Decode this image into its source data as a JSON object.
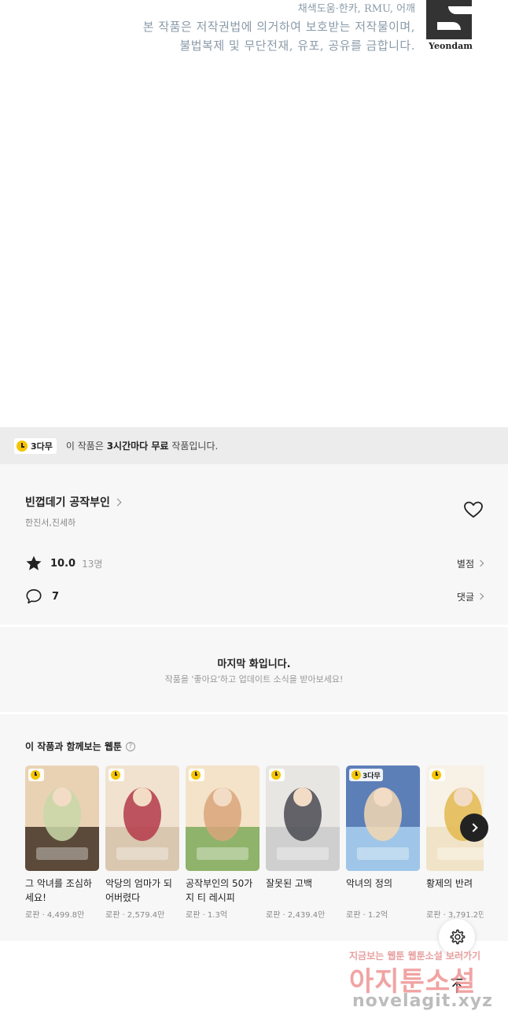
{
  "copyright": {
    "credit": "채색도움·한카, RMU, 어깨",
    "line1": "본 작품은 저작권법에 의거하여 보호받는 저작물이며,",
    "line2": "불법복제 및 무단전재, 유포, 공유를 금합니다.",
    "logo_text": "Yeondam"
  },
  "free_banner": {
    "badge": "3다무",
    "text_before": "이 작품은 ",
    "text_bold": "3시간마다 무료",
    "text_after": " 작품입니다."
  },
  "work": {
    "title": "빈껍데기 공작부인",
    "authors": "한진서,진세하",
    "rating": "10.0",
    "rating_count": "13명",
    "rating_link": "별점",
    "comment_count": "7",
    "comment_link": "댓글"
  },
  "last_episode": {
    "title": "마지막 화입니다.",
    "subtitle": "작품을 '좋아요'하고 업데이트 소식을 받아보세요!"
  },
  "recommendations": {
    "heading": "이 작품과 함께보는 웹툰",
    "items": [
      {
        "title": "그 악녀를 조심하세요!",
        "meta": "로판 · 4,499.8만",
        "badge": "",
        "colors": [
          "#5b4a3a",
          "#c9d8a8",
          "#e9d2b4"
        ]
      },
      {
        "title": "악당의 엄마가 되어버렸다",
        "meta": "로판 · 2,579.4만",
        "badge": "",
        "colors": [
          "#d9c7b0",
          "#b43a4a",
          "#f0e2cf"
        ]
      },
      {
        "title": "공작부인의 50가지 티 레시피",
        "meta": "로판 · 1.3억",
        "badge": "",
        "colors": [
          "#8fb36a",
          "#d9a47a",
          "#f4e3c8"
        ]
      },
      {
        "title": "잘못된 고백",
        "meta": "로판 · 2,439.4만",
        "badge": "",
        "colors": [
          "#cfcfcf",
          "#4a4a52",
          "#e8e6e2"
        ]
      },
      {
        "title": "악녀의 정의",
        "meta": "로판 · 1.2억",
        "badge": "3다무",
        "colors": [
          "#9fc6e8",
          "#f2d7b0",
          "#5d7fb8"
        ]
      },
      {
        "title": "황제의 반려",
        "meta": "로판 · 3,791.2만",
        "badge": "",
        "colors": [
          "#f1e3c7",
          "#e3b94e",
          "#f7f1e6"
        ]
      }
    ]
  },
  "watermark": {
    "small": "지금보는 웹툰 웹툰소설 보러가기",
    "big": "아지툰소설",
    "url": "novelagit.xyz"
  },
  "icons": {
    "heart": "heart-outline-icon",
    "star": "star-icon",
    "comment": "speech-bubble-icon",
    "settings": "gear-icon",
    "top": "arrow-up-icon",
    "next": "chevron-right-icon"
  }
}
